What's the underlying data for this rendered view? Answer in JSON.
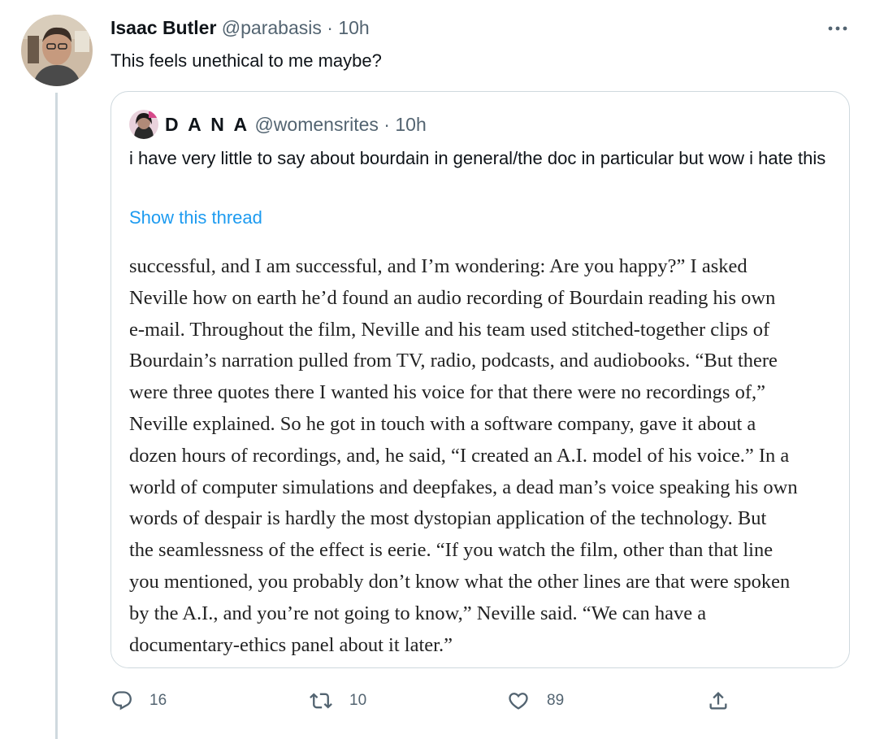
{
  "tweet": {
    "author_name": "Isaac Butler",
    "handle": "@parabasis",
    "separator": "·",
    "time": "10h",
    "text": "This feels unethical to me maybe?",
    "avatar_icon": "person-avatar",
    "more_icon": "more-horizontal-icon"
  },
  "quoted_tweet": {
    "author_name": "D A N A",
    "handle": "@womensrites",
    "separator": "·",
    "time": "10h",
    "text": "i have very little to say about bourdain in general/the doc in particular but wow i hate this",
    "show_thread_label": "Show this thread",
    "image_text_lines": [
      "successful, and I am successful, and I’m wondering: Are you happy?” I asked",
      "Neville how on earth he’d found an audio recording of Bourdain reading his own",
      "e-mail. Throughout the film, Neville and his team used stitched-together clips of",
      "Bourdain’s narration pulled from TV, radio, podcasts, and audiobooks. “But there",
      "were three quotes there I wanted his voice for that there were no recordings of,”",
      "Neville explained. So he got in touch with a software company, gave it about a",
      "dozen hours of recordings, and, he said, “I created an A.I. model of his voice.” In a",
      "world of computer simulations and deepfakes, a dead man’s voice speaking his own",
      "words of despair is hardly the most dystopian application of the technology. But",
      "the seamlessness of the effect is eerie. “If you watch the film, other than that line",
      "you mentioned, you probably don’t know what the other lines are that were spoken",
      "by the A.I., and you’re not going to know,” Neville said. “We can have a",
      "documentary-ethics panel about it later.”"
    ]
  },
  "actions": {
    "reply": {
      "icon": "reply-icon",
      "count": "16"
    },
    "retweet": {
      "icon": "retweet-icon",
      "count": "10"
    },
    "like": {
      "icon": "like-icon",
      "count": "89"
    },
    "share": {
      "icon": "share-icon"
    }
  },
  "colors": {
    "text": "#0f1419",
    "secondary": "#536471",
    "link": "#1d9bf0",
    "border": "#cfd9de"
  }
}
